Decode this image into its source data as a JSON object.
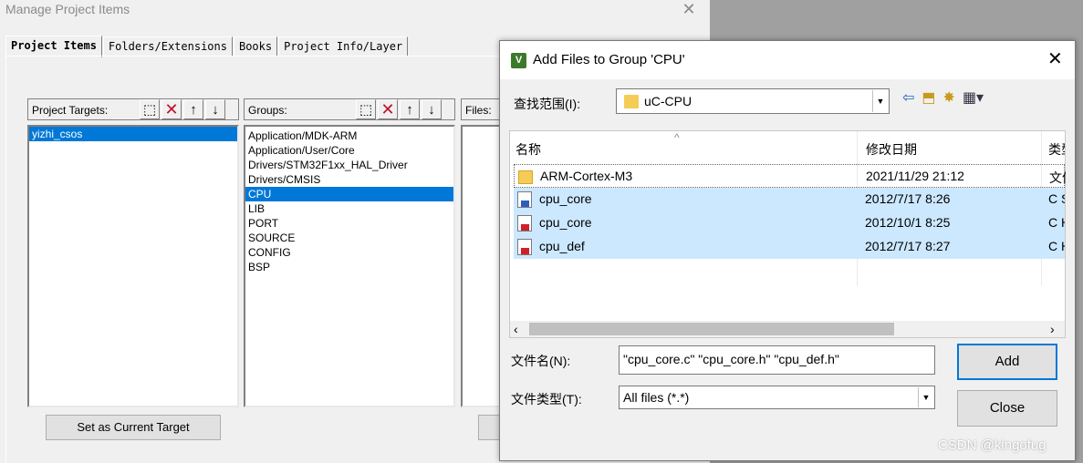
{
  "background_window": {
    "title": "Manage Project Items",
    "close_glyph": "✕",
    "tabs": [
      "Project Items",
      "Folders/Extensions",
      "Books",
      "Project Info/Layer"
    ],
    "targets": {
      "label": "Project Targets:",
      "items": [
        "yizhi_csos"
      ]
    },
    "groups": {
      "label": "Groups:",
      "items": [
        "Application/MDK-ARM",
        "Application/User/Core",
        "Drivers/STM32F1xx_HAL_Driver",
        "Drivers/CMSIS",
        "CPU",
        "LIB",
        "PORT",
        "SOURCE",
        "CONFIG",
        "BSP"
      ],
      "selected_index": 4
    },
    "files": {
      "label": "Files:"
    },
    "set_target_button": "Set as Current Target"
  },
  "dialog": {
    "title": "Add Files to Group 'CPU'",
    "close_glyph": "✕",
    "look_in_label": "查找范围(I):",
    "look_in_value": "uC-CPU",
    "columns": {
      "name": "名称",
      "date": "修改日期",
      "type": "类型"
    },
    "files": [
      {
        "name": "ARM-Cortex-M3",
        "date": "2021/11/29 21:12",
        "type": "文件夹",
        "icon": "folder-icon",
        "selected": false
      },
      {
        "name": "cpu_core",
        "date": "2012/7/17 8:26",
        "type": "C Source",
        "icon": "c-source-file-icon",
        "selected": true
      },
      {
        "name": "cpu_core",
        "date": "2012/10/1 8:25",
        "type": "C Header",
        "icon": "c-header-file-icon",
        "selected": true
      },
      {
        "name": "cpu_def",
        "date": "2012/7/17 8:27",
        "type": "C Header",
        "icon": "c-header-file-icon",
        "selected": true
      }
    ],
    "filename_label": "文件名(N):",
    "filename_value": "\"cpu_core.c\" \"cpu_core.h\" \"cpu_def.h\"",
    "filetype_label": "文件类型(T):",
    "filetype_value": "All files (*.*)",
    "add_button": "Add",
    "close_button": "Close"
  },
  "watermark": "CSDN @kingofug"
}
